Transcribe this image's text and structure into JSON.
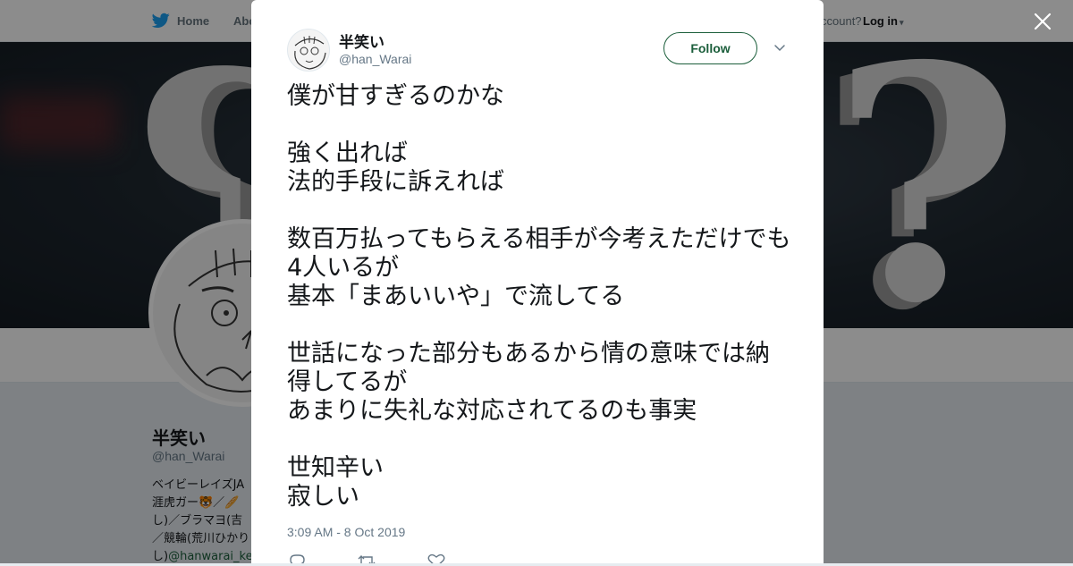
{
  "nav": {
    "home_label": "Home",
    "about_label": "Abo",
    "account_text": "ccount?",
    "login_label": "Log in"
  },
  "profile": {
    "name": "半笑い",
    "handle": "@han_Warai",
    "bio_lines": [
      "ベイビーレイズJA",
      "涯虎ガー🐯／🥖",
      "し)／ブラマヨ(吉",
      "／競輪(荒川ひかり",
      "し)"
    ],
    "bio_mention": "@hanwarai_ke"
  },
  "tweet": {
    "name": "半笑い",
    "handle": "@han_Warai",
    "follow_label": "Follow",
    "text": "僕が甘すぎるのかな\n\n強く出れば\n法的手段に訴えれば\n\n数百万払ってもらえる相手が今考えただけでも4人いるが\n基本「まあいいや」で流してる\n\n世話になった部分もあるから情の意味では納得してるが\nあまりに失礼な対応されてるのも事実\n\n世知辛い\n寂しい",
    "timestamp": "3:09 AM - 8 Oct 2019"
  },
  "icons": {
    "brand": "twitter-bird-icon",
    "close": "close-icon",
    "more": "chevron-down-icon",
    "reply": "reply-icon",
    "retweet": "retweet-icon",
    "like": "heart-icon"
  },
  "colors": {
    "follow": "#1b5e3b",
    "twitter_blue": "#1da1f2",
    "overlay": "rgba(0,0,0,0.45)"
  }
}
